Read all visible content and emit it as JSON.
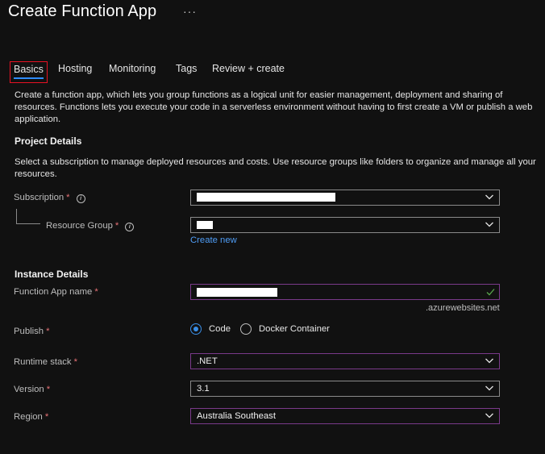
{
  "header": {
    "title": "Create Function App",
    "more_label": "···"
  },
  "tabs": [
    {
      "label": "Basics",
      "active": true
    },
    {
      "label": "Hosting",
      "active": false
    },
    {
      "label": "Monitoring",
      "active": false
    },
    {
      "label": "Tags",
      "active": false
    },
    {
      "label": "Review + create",
      "active": false
    }
  ],
  "intro": {
    "text": "Create a function app, which lets you group functions as a logical unit for easier management, deployment and sharing of resources. Functions lets you execute your code in a serverless environment without having to first create a VM or publish a web application."
  },
  "project_details": {
    "heading": "Project Details",
    "text": "Select a subscription to manage deployed resources and costs. Use resource groups like folders to organize and manage all your resources.",
    "subscription_label": "Subscription",
    "resource_group_label": "Resource Group",
    "create_new_label": "Create new"
  },
  "instance_details": {
    "heading": "Instance Details",
    "function_app_name_label": "Function App name",
    "domain_suffix": ".azurewebsites.net",
    "publish_label": "Publish",
    "publish_options": [
      "Code",
      "Docker Container"
    ],
    "publish_selected": "Code",
    "runtime_stack_label": "Runtime stack",
    "runtime_stack_value": ".NET",
    "version_label": "Version",
    "version_value": "3.1",
    "region_label": "Region",
    "region_value": "Australia Southeast"
  },
  "required_marker": "*",
  "info_glyph": "i",
  "colors": {
    "background": "#111111",
    "accent": "#2f8cff",
    "required": "#e87377",
    "link": "#4f9df6",
    "focus_border": "#7a3a8a",
    "active_tab_outline": "#e81123",
    "valid_check": "#57a64a"
  },
  "icons": {
    "dropdown": "chevron-down-icon",
    "info": "info-icon",
    "valid": "checkmark-icon"
  }
}
